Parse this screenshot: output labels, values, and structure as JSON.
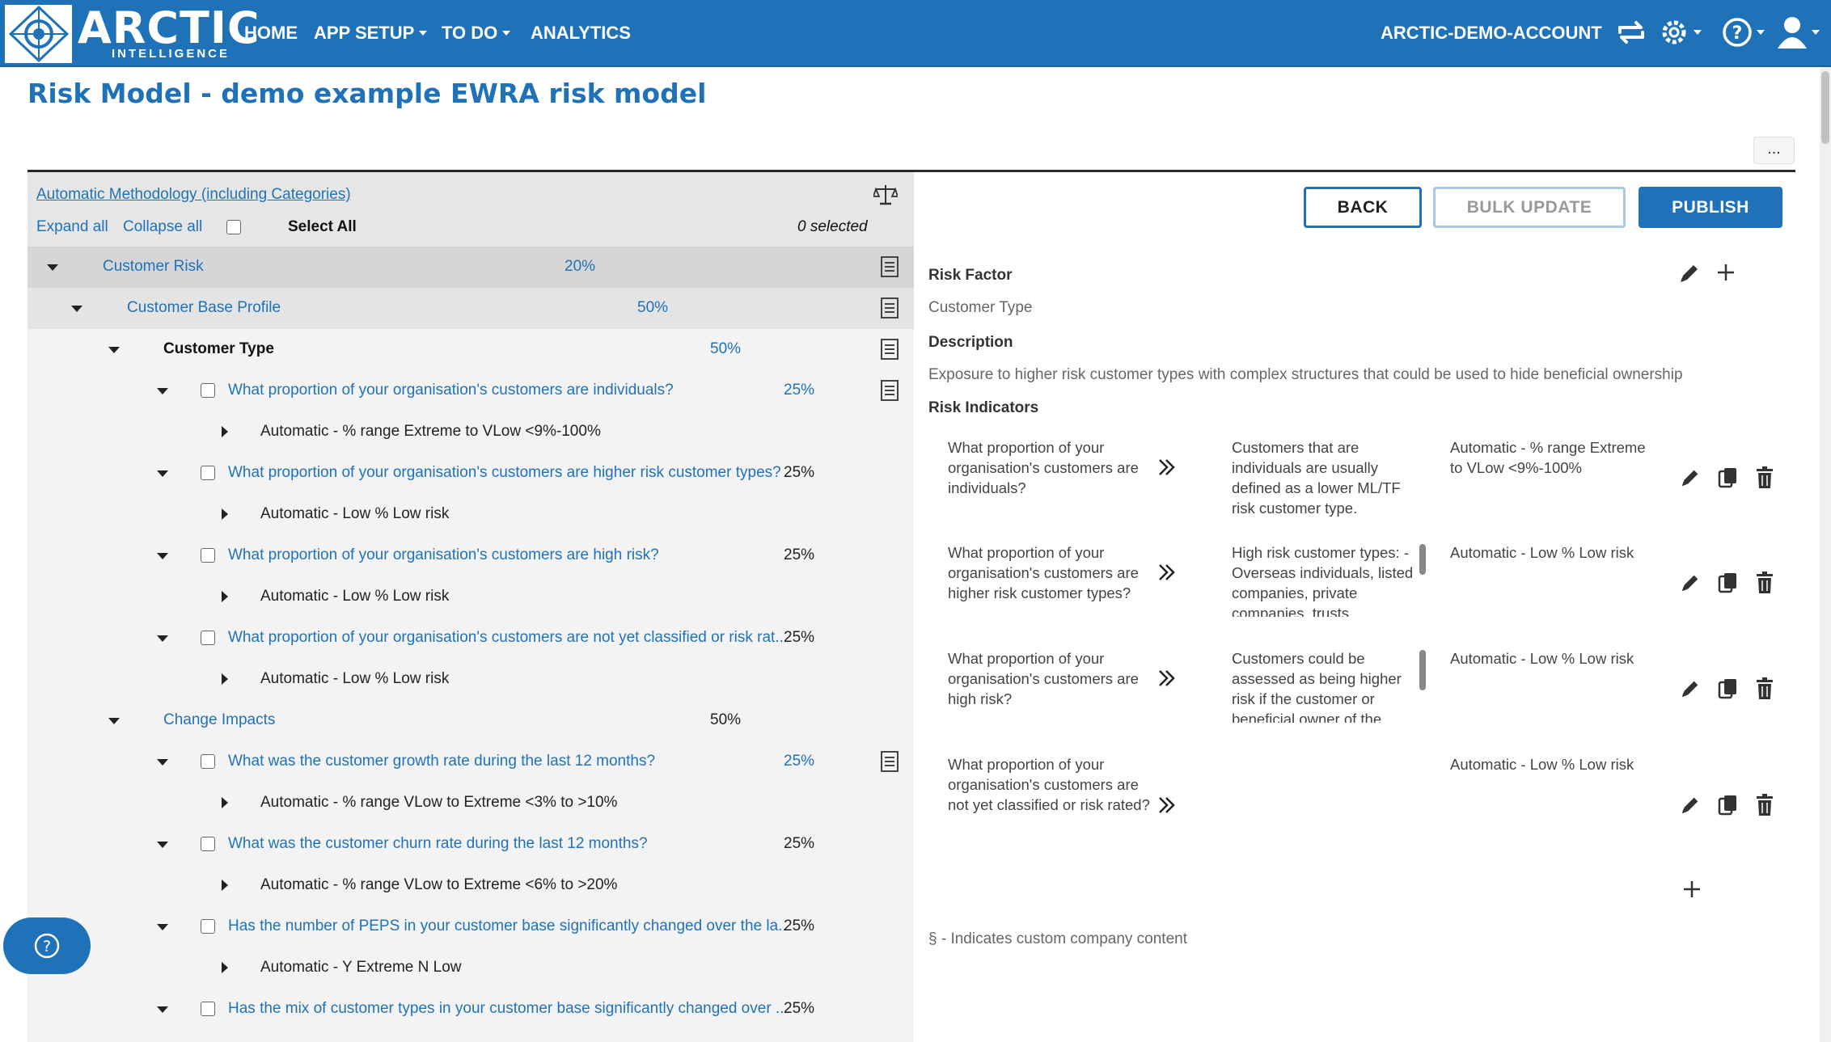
{
  "header": {
    "logo_text": "ARCTIC",
    "logo_sub": "INTELLIGENCE",
    "nav": [
      {
        "label": "HOME"
      },
      {
        "label": "APP SETUP"
      },
      {
        "label": "TO DO"
      },
      {
        "label": "ANALYTICS"
      }
    ],
    "account": "ARCTIC-DEMO-ACCOUNT"
  },
  "page": {
    "title": "Risk Model - demo example EWRA risk model",
    "more": "..."
  },
  "left": {
    "methodology_link": "Automatic Methodology (including Categories)",
    "expand_all": "Expand all",
    "collapse_all": "Collapse all",
    "select_all": "Select All",
    "selected_count": "0 selected",
    "rows": [
      {
        "label": "Customer Risk",
        "pct": "20%"
      },
      {
        "label": "Customer Base Profile",
        "pct": "50%"
      },
      {
        "label": "Customer Type",
        "pct": "50%"
      },
      {
        "label": "What proportion of your organisation's customers are individuals?",
        "pct": "25%"
      },
      {
        "label": "Automatic - % range Extreme to VLow <9%-100%"
      },
      {
        "label": "What proportion of your organisation's customers are higher risk customer types?",
        "pct": "25%"
      },
      {
        "label": "Automatic - Low % Low risk"
      },
      {
        "label": "What proportion of your organisation's customers are high risk?",
        "pct": "25%"
      },
      {
        "label": "Automatic - Low % Low risk"
      },
      {
        "label": "What proportion of your organisation's customers are not yet classified or risk rat...",
        "pct": "25%"
      },
      {
        "label": "Automatic - Low % Low risk"
      },
      {
        "label": "Change Impacts",
        "pct": "50%"
      },
      {
        "label": "What was the customer growth rate during the last 12 months?",
        "pct": "25%"
      },
      {
        "label": "Automatic - % range VLow to Extreme <3% to >10%"
      },
      {
        "label": "What was the customer churn rate during the last 12 months?",
        "pct": "25%"
      },
      {
        "label": "Automatic - % range VLow to Extreme <6% to >20%"
      },
      {
        "label": "Has the number of PEPS in your customer base significantly changed over the la...",
        "pct": "25%"
      },
      {
        "label": "Automatic - Y Extreme N Low"
      },
      {
        "label": "Has the mix of customer types in your customer base significantly changed over ...",
        "pct": "25%"
      }
    ]
  },
  "right": {
    "back": "BACK",
    "bulk_update": "BULK UPDATE",
    "publish": "PUBLISH",
    "risk_factor_label": "Risk Factor",
    "risk_factor_value": "Customer Type",
    "description_label": "Description",
    "description_value": "Exposure to higher risk customer types with complex structures that could be used to hide beneficial ownership",
    "indicators_label": "Risk Indicators",
    "indicators": [
      {
        "question": "What proportion of your organisation's customers are individuals?",
        "description": "Customers that are individuals are usually defined as a lower ML/TF risk customer type.",
        "method": "Automatic - % range Extreme to VLow <9%-100%"
      },
      {
        "question": "What proportion of your organisation's customers are higher risk customer types?",
        "description": "High risk customer types: - Overseas individuals, listed companies, private companies, trusts,",
        "method": "Automatic - Low % Low risk"
      },
      {
        "question": "What proportion of your organisation's customers are high risk?",
        "description": "Customers could be assessed as being higher risk if the customer or beneficial owner of the",
        "method": "Automatic - Low % Low risk"
      },
      {
        "question": "What proportion of your organisation's customers are not yet classified or risk rated?",
        "description": "",
        "method": "Automatic - Low % Low risk"
      }
    ],
    "footnote": "§ - Indicates custom company content"
  }
}
